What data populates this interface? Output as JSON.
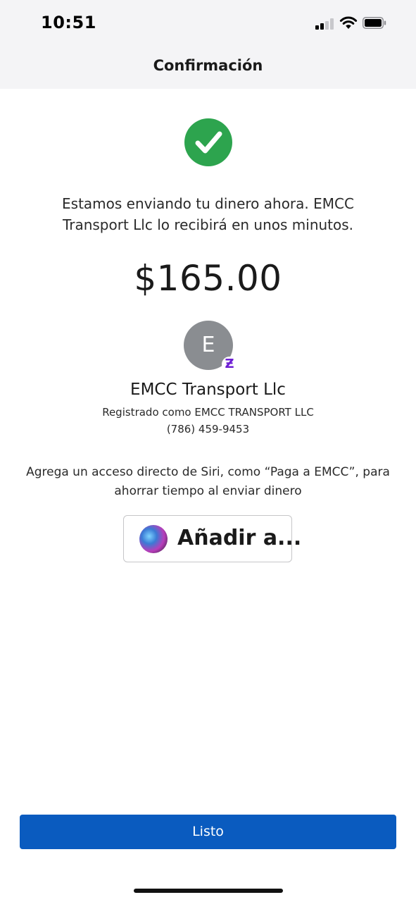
{
  "status_bar": {
    "time": "10:51",
    "icons": [
      "cellular-signal-icon",
      "wifi-icon",
      "battery-icon"
    ]
  },
  "header": {
    "title": "Confirmación"
  },
  "main": {
    "success_icon": "checkmark-circle-icon",
    "message": "Estamos enviando tu dinero ahora. EMCC Transport Llc lo recibirá en unos minutos.",
    "amount": "$165.00",
    "recipient": {
      "avatar_initial": "E",
      "badge_icon": "zelle-icon",
      "badge_glyph": "Ƶ",
      "name": "EMCC Transport Llc",
      "registered_as": "Registrado como EMCC TRANSPORT LLC",
      "phone": "(786) 459-9453"
    },
    "siri": {
      "description": "Agrega un acceso directo de Siri, como “Paga a EMCC”, para ahorrar tiempo al enviar dinero",
      "button_label": "Añadir a...",
      "icon": "siri-icon"
    }
  },
  "footer": {
    "done_label": "Listo"
  },
  "colors": {
    "success": "#2da44e",
    "primary_button": "#0a5bbf",
    "zelle_purple": "#6d1ed4",
    "avatar_gray": "#8a8d91",
    "header_background": "#f4f4f6"
  }
}
